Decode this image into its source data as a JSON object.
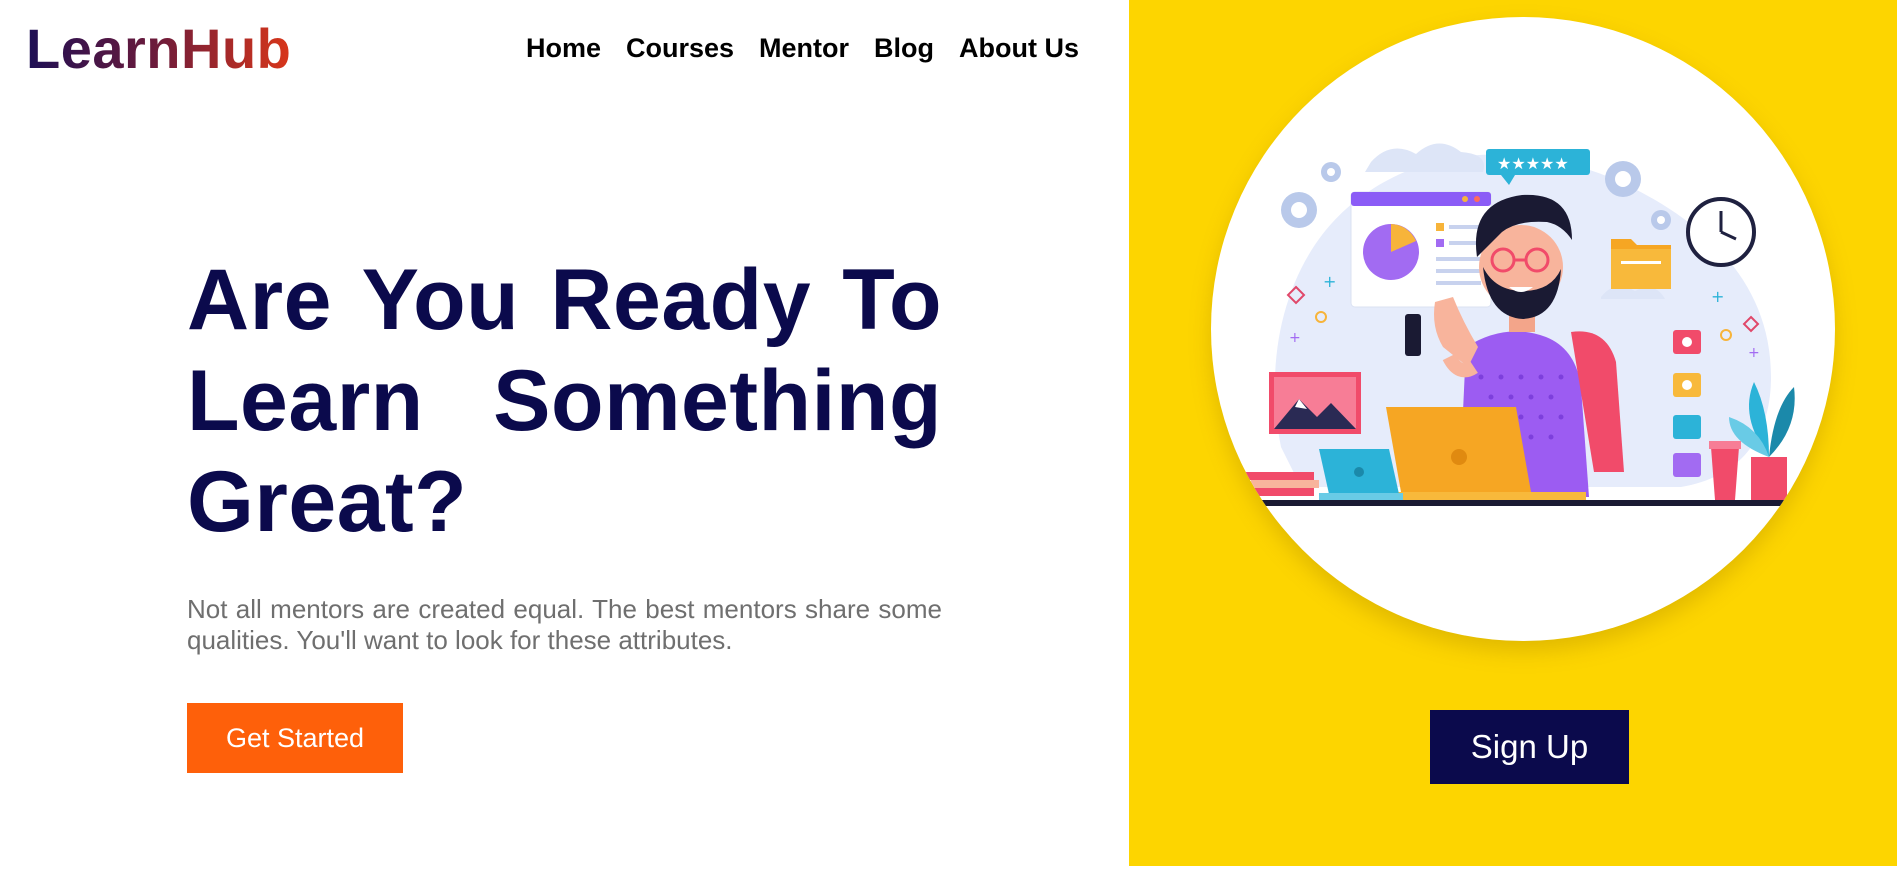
{
  "brand": {
    "logo": "LearnHub"
  },
  "nav": {
    "items": [
      {
        "label": "Home"
      },
      {
        "label": "Courses"
      },
      {
        "label": "Mentor"
      },
      {
        "label": "Blog"
      },
      {
        "label": "About Us"
      }
    ]
  },
  "hero": {
    "headline": "Are You Ready To Learn  Something Great?",
    "subtext": "Not all mentors are created equal. The best mentors share some qualities. You'll want to look for these attributes.",
    "cta_label": "Get Started"
  },
  "aside": {
    "signup_label": "Sign Up",
    "illustration_icon": "online-learning-illustration"
  },
  "colors": {
    "brand_dark": "#0b0a4c",
    "accent_orange": "#fe600a",
    "panel_yellow": "#fdd500"
  }
}
